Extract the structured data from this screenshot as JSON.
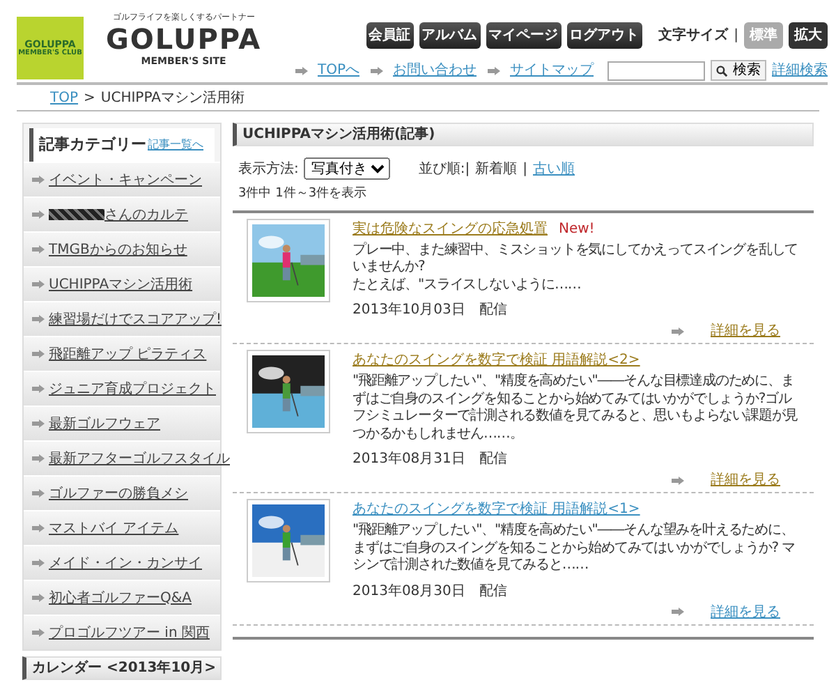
{
  "header": {
    "logo": "GOLUPPA",
    "logo_sub": "MEMBER'S CLUB",
    "tagline": "ゴルフライフを楽しくするパートナー",
    "site_name": "GOLUPPA",
    "site_sub": "MEMBER'S SITE",
    "nav_buttons": [
      "会員証",
      "アルバム",
      "マイページ",
      "ログアウト"
    ],
    "font_size": {
      "label": "文字サイズ",
      "separator": "|",
      "options": [
        {
          "label": "標準",
          "selected": false
        },
        {
          "label": "拡大",
          "selected": true
        }
      ]
    },
    "links": [
      "TOPへ",
      "お問い合わせ",
      "サイトマップ"
    ],
    "search": {
      "button": "検索",
      "advanced": "詳細検索"
    }
  },
  "breadcrumb_separator": ">",
  "breadcrumb": [
    {
      "label": "TOP",
      "link": true
    },
    {
      "label": "UCHIPPAマシン活用術",
      "link": false
    }
  ],
  "sidebar": {
    "title": "記事カテゴリー",
    "all_link": "記事一覧へ",
    "items": [
      {
        "label": "イベント・キャンペーン",
        "redacted": false
      },
      {
        "label": "さんのカルテ",
        "redacted": true
      },
      {
        "label": "TMGBからのお知らせ",
        "redacted": false
      },
      {
        "label": "UCHIPPAマシン活用術",
        "redacted": false
      },
      {
        "label": "練習場だけでスコアアップ!",
        "redacted": false
      },
      {
        "label": "飛距離アップ ピラティス",
        "redacted": false
      },
      {
        "label": "ジュニア育成プロジェクト",
        "redacted": false
      },
      {
        "label": "最新ゴルフウェア",
        "redacted": false
      },
      {
        "label": "最新アフターゴルフスタイル",
        "redacted": false
      },
      {
        "label": "ゴルファーの勝負メシ",
        "redacted": false
      },
      {
        "label": "マストバイ アイテム",
        "redacted": false
      },
      {
        "label": "メイド・イン・カンサイ",
        "redacted": false
      },
      {
        "label": "初心者ゴルファーQ&A",
        "redacted": false
      },
      {
        "label": "プロゴルフツアー in 関西",
        "redacted": false
      }
    ],
    "calendar_title": "カレンダー <2013年10月>"
  },
  "main": {
    "title": "UCHIPPAマシン活用術(記事)",
    "display_label": "表示方法:",
    "display_value": "写真付き",
    "sort_label": "並び順:|",
    "sort_separator": "|",
    "sort_options": [
      {
        "label": "新着順",
        "selected": true
      },
      {
        "label": "古い順",
        "selected": false
      }
    ],
    "count": "3件中 1件～3件を表示",
    "articles": [
      {
        "title": "実は危険なスイングの応急処置",
        "new": "New!",
        "visited": true,
        "body": "プレー中、また練習中、ミスショットを気にしてかえってスイングを乱していませんか?\nたとえば、\"スライスしないように……",
        "date": "2013年10月03日　配信",
        "more": "詳細を見る",
        "kind": "picture"
      },
      {
        "title": "あなたのスイングを数字で検証 用語解説<2>",
        "visited": true,
        "body": "\"飛距離アップしたい\"、\"精度を高めたい\"――そんな目標達成のために、まずはご自身のスイングを知ることから始めてみてはいかがでしょうか?ゴルフシミュレーターで計測される数値を見てみると、思いもよらない課題が見つかるかもしれません……。",
        "date": "2013年08月31日　配信",
        "more": "詳細を見る",
        "kind": "picture"
      },
      {
        "title": "あなたのスイングを数字で検証 用語解説<1>",
        "visited": false,
        "body": "\"飛距離アップしたい\"、\"精度を高めたい\"――そんな望みを叶えるために、まずはご自身のスイングを知ることから始めてみてはいかがでしょうか? マシンで計測された数値を見てみると……",
        "date": "2013年08月30日　配信",
        "more": "詳細を見る",
        "kind": "picture"
      }
    ]
  }
}
